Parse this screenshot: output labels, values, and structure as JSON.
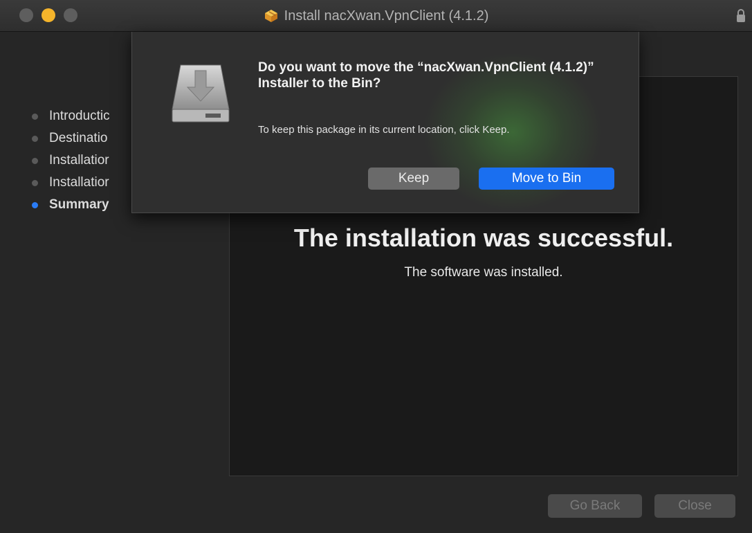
{
  "window": {
    "title": "Install nacXwan.VpnClient (4.1.2)",
    "title_icon": "package-icon",
    "lock_icon": "lock-icon"
  },
  "colors": {
    "accent": "#1a6ff0",
    "active_step": "#2a7cf6",
    "minimize": "#f5b42b"
  },
  "sidebar": {
    "items": [
      {
        "label": "Introductic",
        "active": false
      },
      {
        "label": "Destinatio",
        "active": false
      },
      {
        "label": "Installatior",
        "active": false
      },
      {
        "label": "Installatior",
        "active": false
      },
      {
        "label": "Summary",
        "active": true
      }
    ]
  },
  "main": {
    "title": "The installation was successful.",
    "subtitle": "The software was installed."
  },
  "footer": {
    "go_back_label": "Go Back",
    "close_label": "Close"
  },
  "dialog": {
    "icon": "drive-download-icon",
    "title": "Do you want to move the “nacXwan.VpnClient (4.1.2)” Installer to the Bin?",
    "message": "To keep this package in its current location, click Keep.",
    "keep_label": "Keep",
    "move_label": "Move to Bin"
  }
}
